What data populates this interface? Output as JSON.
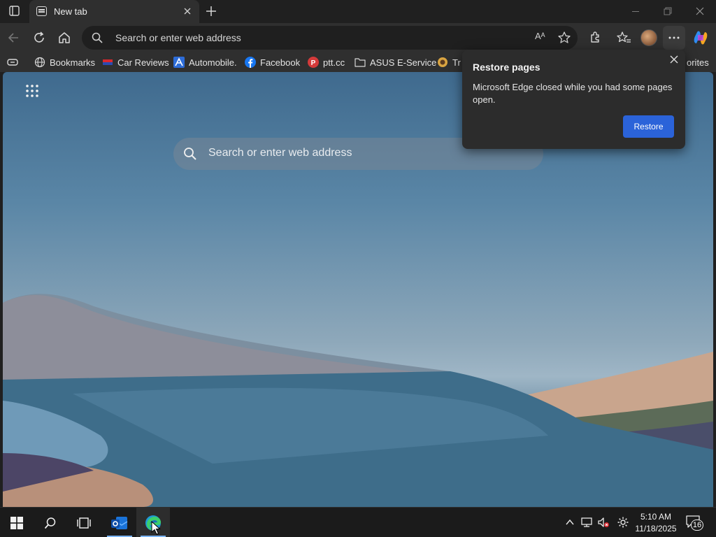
{
  "browser": {
    "tab": {
      "title": "New tab"
    },
    "address_bar": {
      "placeholder": "Search or enter web address",
      "read_aloud": "Aᴬ"
    },
    "bookmarks": [
      {
        "label": "Bookmarks",
        "icon": "globe-icon"
      },
      {
        "label": "Car Reviews",
        "icon": "car-reviews-icon"
      },
      {
        "label": "Automobile.",
        "icon": "automobile-icon"
      },
      {
        "label": "Facebook",
        "icon": "facebook-icon"
      },
      {
        "label": "ptt.cc",
        "icon": "ptt-icon"
      },
      {
        "label": "ASUS E-Service",
        "icon": "folder-icon"
      },
      {
        "label": "Tr",
        "icon": "tr-icon"
      },
      {
        "label": "orites",
        "icon": "other-favorites"
      }
    ]
  },
  "new_tab_page": {
    "search_placeholder": "Search or enter web address"
  },
  "restore_popup": {
    "title": "Restore pages",
    "message": "Microsoft Edge closed while you had some pages open.",
    "button": "Restore"
  },
  "taskbar": {
    "time": "5:10 AM",
    "date": "11/18/2025",
    "notification_count": "16"
  },
  "colors": {
    "accent_button": "#2b63d9",
    "taskbar_indicator": "#7cb5f5",
    "popup_bg": "#2c2c2c"
  }
}
